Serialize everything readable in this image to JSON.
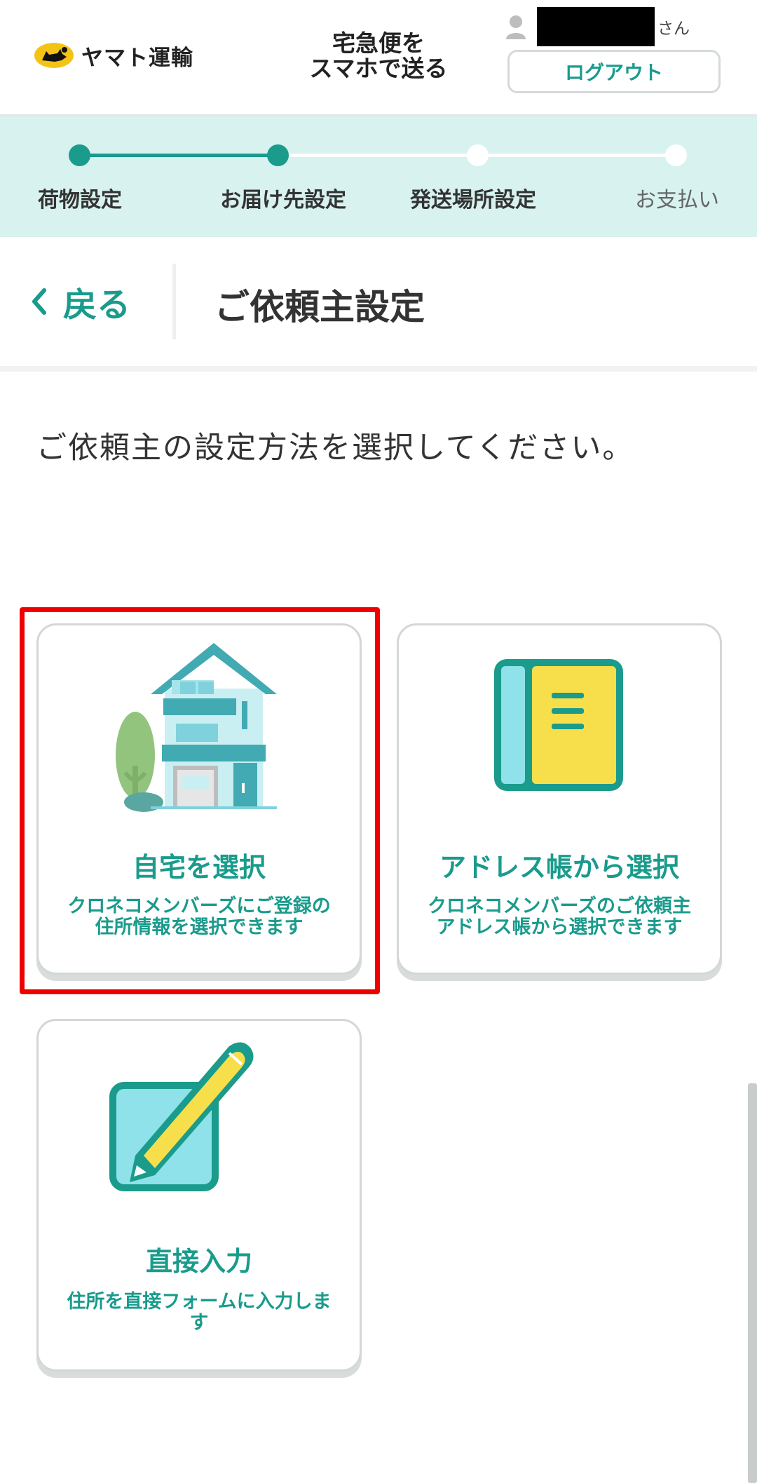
{
  "header": {
    "logo_text": "ヤマト運輸",
    "service_title_line1": "宅急便を",
    "service_title_line2": "スマホで送る",
    "user_suffix": "さん",
    "logout_label": "ログアウト"
  },
  "steps": [
    {
      "label": "荷物設定",
      "state": "done"
    },
    {
      "label": "お届け先設定",
      "state": "current"
    },
    {
      "label": "発送場所設定",
      "state": "pending"
    },
    {
      "label": "お支払い",
      "state": "pending"
    }
  ],
  "page": {
    "back_label": "戻る",
    "title": "ご依頼主設定",
    "instruction": "ご依頼主の設定方法を選択してください。"
  },
  "options": [
    {
      "title": "自宅を選択",
      "desc_line1": "クロネコメンバーズにご登録の",
      "desc_line2": "住所情報を選択できます",
      "icon": "house-icon"
    },
    {
      "title": "アドレス帳から選択",
      "desc_line1": "クロネコメンバーズのご依頼主",
      "desc_line2": "アドレス帳から選択できます",
      "icon": "address-book-icon"
    },
    {
      "title": "直接入力",
      "desc_line1": "住所を直接フォームに入力しま",
      "desc_line2": "す",
      "icon": "pencil-icon"
    }
  ],
  "colors": {
    "accent": "#1a9b8c",
    "step_bg": "#d7f2ef",
    "highlight": "#ee0000"
  }
}
